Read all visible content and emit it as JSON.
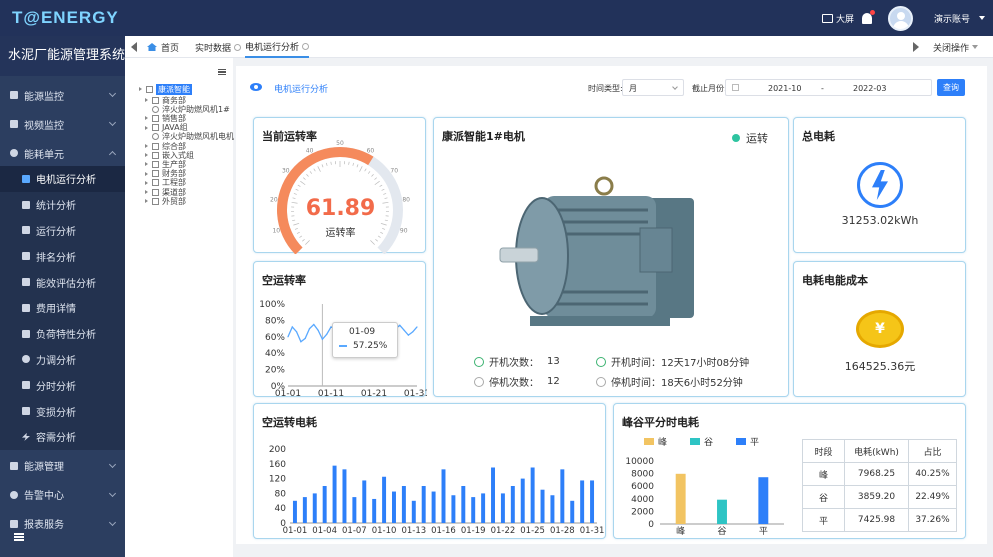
{
  "header": {
    "logo": "T@ENERGY",
    "screen_label": "大屏",
    "user_name": "演示账号"
  },
  "sidebar": {
    "title": "水泥厂能源管理系统",
    "items": [
      {
        "label": "能源监控"
      },
      {
        "label": "视频监控"
      },
      {
        "label": "能耗单元"
      }
    ],
    "sub_items": [
      {
        "label": "电机运行分析"
      },
      {
        "label": "统计分析"
      },
      {
        "label": "运行分析"
      },
      {
        "label": "排名分析"
      },
      {
        "label": "能效评估分析"
      },
      {
        "label": "费用详情"
      },
      {
        "label": "负荷特性分析"
      },
      {
        "label": "力调分析"
      },
      {
        "label": "分时分析"
      },
      {
        "label": "变损分析"
      },
      {
        "label": "容需分析"
      }
    ],
    "bottom_items": [
      {
        "label": "能源管理"
      },
      {
        "label": "告警中心"
      },
      {
        "label": "报表服务"
      }
    ]
  },
  "tabs": {
    "home": "首页",
    "realtime": "实时数据",
    "current": "电机运行分析",
    "close_ops": "关闭操作"
  },
  "tree": {
    "root": "康派智能",
    "nodes": [
      "商务部",
      "淬火炉助燃风机1#",
      "销售部",
      "JAVA组",
      "淬火炉助燃风机电机",
      "综合部",
      "嵌入式组",
      "生产部",
      "财务部",
      "工程部",
      "渠道部",
      "外贸部"
    ]
  },
  "page": {
    "title": "电机运行分析",
    "time_type_label": "时间类型:",
    "time_type_value": "月",
    "end_month_label": "截止月份:",
    "date_from": "2021-10",
    "date_sep": "-",
    "date_to": "2022-03",
    "query_button": "查询"
  },
  "cards": {
    "rate": {
      "title": "当前运转率",
      "value": "61.89",
      "sub": "运转率",
      "gauge_value": 61.89,
      "gauge_ticks": [
        "0",
        "10",
        "20",
        "30",
        "40",
        "50",
        "60",
        "70",
        "80",
        "90",
        "100"
      ]
    },
    "motor": {
      "title": "康派智能1#电机",
      "status": "运转",
      "start_count_label": "开机次数：",
      "start_count": "13",
      "stop_count_label": "停机次数：",
      "stop_count": "12",
      "start_time_label": "开机时间：",
      "start_time": "12天17小时08分钟",
      "stop_time_label": "停机时间：",
      "stop_time": "18天6小时52分钟"
    },
    "total": {
      "title": "总电耗",
      "value": "31253.02kWh"
    },
    "cost": {
      "title": "电耗电能成本",
      "value": "164525.36元",
      "coin_symbol": "¥"
    },
    "idle": {
      "title": "空运转率",
      "tooltip_date": "01-09",
      "tooltip_value": "57.25%"
    },
    "idle_energy": {
      "title": "空运转电耗"
    },
    "peak": {
      "title": "峰谷平分时电耗",
      "table_header": [
        "时段",
        "电耗(kWh)",
        "占比"
      ],
      "table_rows": [
        [
          "峰",
          "7968.25",
          "40.25%"
        ],
        [
          "谷",
          "3859.20",
          "22.49%"
        ],
        [
          "平",
          "7425.98",
          "37.26%"
        ]
      ]
    }
  },
  "chart_data": [
    {
      "type": "line",
      "title": "空运转率",
      "x": [
        "01-01",
        "01-02",
        "01-03",
        "01-04",
        "01-05",
        "01-06",
        "01-07",
        "01-08",
        "01-09",
        "01-10",
        "01-11",
        "01-12",
        "01-13",
        "01-14",
        "01-15",
        "01-16",
        "01-17",
        "01-18",
        "01-19",
        "01-20",
        "01-21",
        "01-22",
        "01-23",
        "01-24",
        "01-25",
        "01-26",
        "01-27",
        "01-28",
        "01-29",
        "01-30",
        "01-31"
      ],
      "xticks": [
        "01-01",
        "01-11",
        "01-21",
        "01-31"
      ],
      "yticks": [
        "0%",
        "20%",
        "40%",
        "60%",
        "80%",
        "100%"
      ],
      "ylim": [
        0,
        100
      ],
      "values": [
        60,
        72,
        66,
        54,
        58,
        70,
        75,
        68,
        57,
        63,
        72,
        70,
        58,
        60,
        66,
        74,
        70,
        62,
        58,
        64,
        70,
        72,
        66,
        60,
        62,
        70,
        74,
        68,
        62,
        66,
        72
      ]
    },
    {
      "type": "bar",
      "title": "空运转电耗",
      "categories": [
        "01-01",
        "01-02",
        "01-03",
        "01-04",
        "01-05",
        "01-06",
        "01-07",
        "01-08",
        "01-09",
        "01-10",
        "01-11",
        "01-12",
        "01-13",
        "01-14",
        "01-15",
        "01-16",
        "01-17",
        "01-18",
        "01-19",
        "01-20",
        "01-21",
        "01-22",
        "01-23",
        "01-24",
        "01-25",
        "01-26",
        "01-27",
        "01-28",
        "01-29",
        "01-30",
        "01-31"
      ],
      "xticks": [
        "01-01",
        "01-04",
        "01-07",
        "01-10",
        "01-13",
        "01-16",
        "01-19",
        "01-22",
        "01-25",
        "01-28",
        "01-31"
      ],
      "yticks": [
        "0",
        "40",
        "80",
        "120",
        "160",
        "200"
      ],
      "ylim": [
        0,
        200
      ],
      "values": [
        60,
        70,
        80,
        100,
        155,
        145,
        70,
        115,
        65,
        125,
        85,
        100,
        60,
        100,
        85,
        145,
        75,
        100,
        70,
        80,
        150,
        80,
        100,
        120,
        150,
        90,
        75,
        145,
        60,
        115,
        115
      ]
    },
    {
      "type": "bar",
      "title": "峰谷平分时电耗",
      "categories": [
        "峰",
        "谷",
        "平"
      ],
      "legend": [
        "峰",
        "谷",
        "平"
      ],
      "colors": [
        "#f2c462",
        "#2ec4c4",
        "#2d7ff9"
      ],
      "yticks": [
        "0",
        "2000",
        "4000",
        "6000",
        "8000",
        "10000"
      ],
      "ylim": [
        0,
        10000
      ],
      "values": [
        7968.25,
        3859.2,
        7425.98
      ]
    }
  ]
}
